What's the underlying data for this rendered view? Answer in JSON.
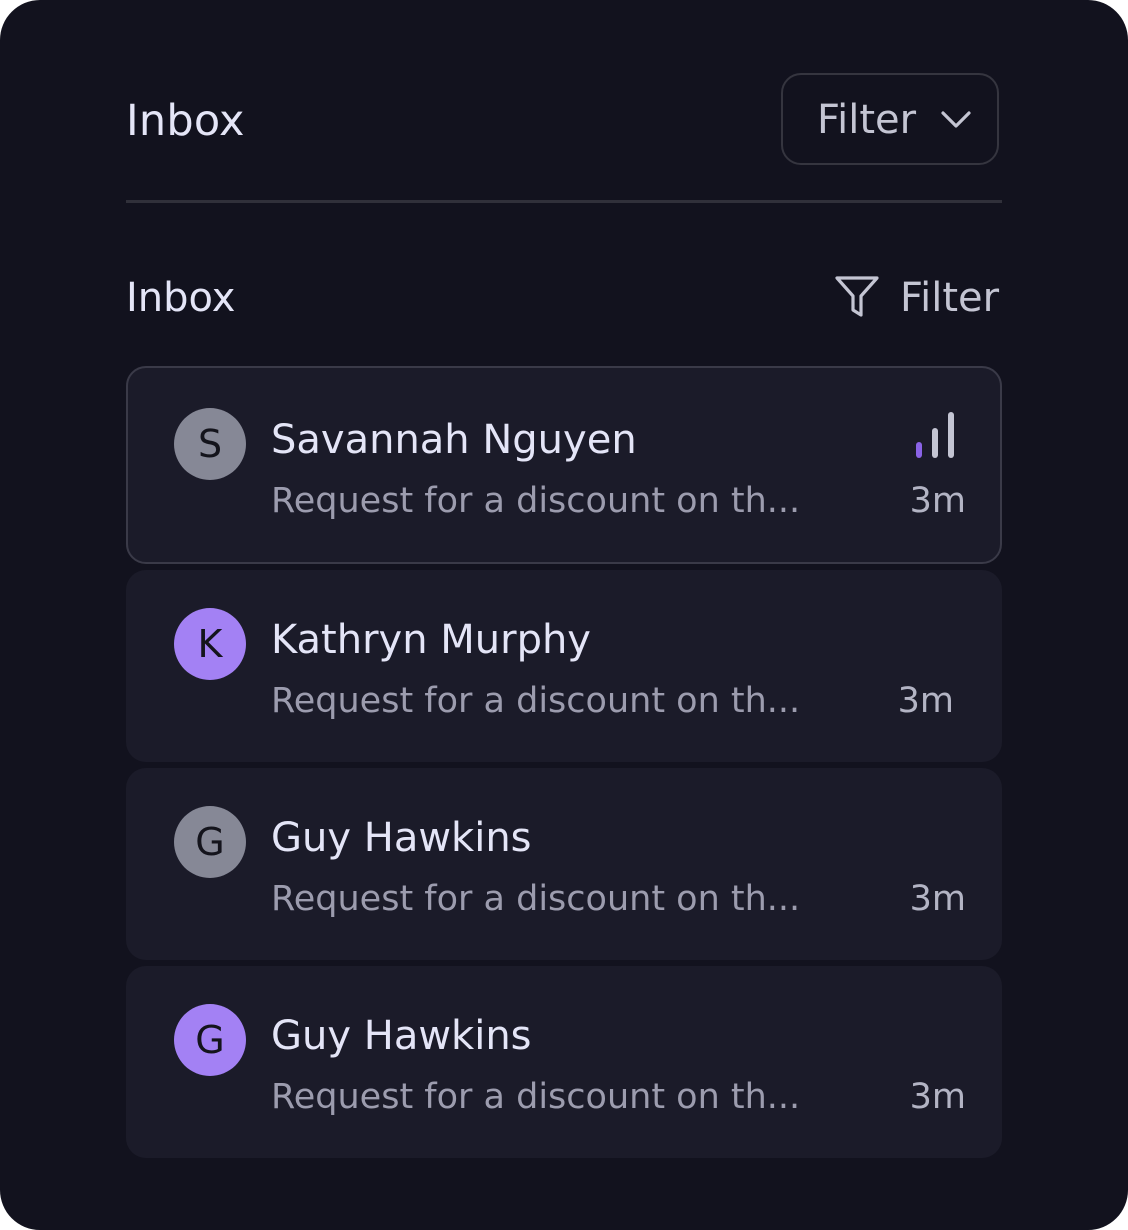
{
  "header": {
    "title": "Inbox",
    "filter_dropdown_label": "Filter",
    "filter_dropdown_icon": "chevron-down-icon"
  },
  "subheader": {
    "title": "Inbox",
    "filter_label": "Filter",
    "filter_icon": "funnel-icon"
  },
  "colors": {
    "background": "#12121e",
    "card": "#1b1b29",
    "accent": "#a381f4",
    "avatar_gray": "#868896"
  },
  "messages": [
    {
      "initial": "S",
      "sender": "Savannah Nguyen",
      "preview": "Request for a discount on th...",
      "time": "3m",
      "avatar_color": "gray",
      "selected": true,
      "priority_icon": "signal-bars-icon",
      "priority_level": 1,
      "priority_max": 3
    },
    {
      "initial": "K",
      "sender": "Kathryn Murphy",
      "preview": "Request for a discount on th...",
      "time": "3m",
      "avatar_color": "purple",
      "selected": false
    },
    {
      "initial": "G",
      "sender": "Guy Hawkins",
      "preview": "Request for a discount on th...",
      "time": "3m",
      "avatar_color": "gray",
      "selected": false
    },
    {
      "initial": "G",
      "sender": "Guy Hawkins",
      "preview": "Request for a discount on th...",
      "time": "3m",
      "avatar_color": "purple",
      "selected": false
    }
  ]
}
